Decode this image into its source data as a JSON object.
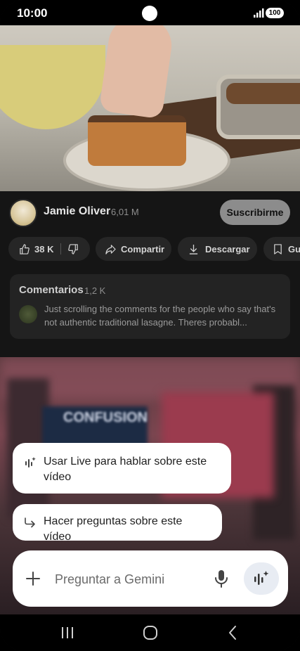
{
  "status_bar": {
    "time": "10:00",
    "battery": "100"
  },
  "channel": {
    "name": "Jamie Oliver",
    "subscribers": "6,01 M",
    "subscribe_label": "Suscribirme"
  },
  "actions": {
    "likes": "38 K",
    "share": "Compartir",
    "download": "Descargar",
    "save": "Gu"
  },
  "comments": {
    "title": "Comentarios",
    "count": "1,2 K",
    "preview": "Just scrolling the comments for the people who say that's not authentic traditional lasagne. Theres probabl..."
  },
  "next_video": {
    "blurred_text": "CONFUSION"
  },
  "gemini": {
    "suggestion_live": "Usar Live para hablar sobre este vídeo",
    "suggestion_ask": "Hacer preguntas sobre este vídeo",
    "input_placeholder": "Preguntar a Gemini"
  },
  "icons": {
    "like": "thumb-up-icon",
    "dislike": "thumb-down-icon",
    "share": "share-arrow-icon",
    "download": "download-icon",
    "save": "bookmark-icon",
    "live": "gemini-live-icon",
    "ask": "reply-arrow-icon",
    "plus": "plus-icon",
    "mic": "microphone-icon"
  },
  "colors": {
    "subscribe_bg": "#8c8c8c",
    "live_button_bg": "#e8ecf3"
  }
}
